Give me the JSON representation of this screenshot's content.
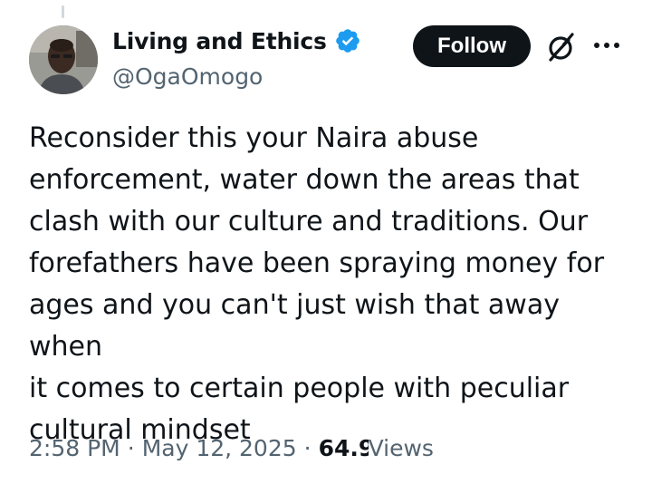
{
  "author": {
    "display_name": "Living and Ethics",
    "handle": "@OgaOmogo",
    "verified": true,
    "verified_color": "#1d9bf0"
  },
  "actions": {
    "follow_label": "Follow",
    "grok_icon": "grok-icon",
    "more_icon": "more-icon"
  },
  "tweet": {
    "text": "Reconsider this your Naira abuse\nenforcement, water down the areas that\nclash with our culture and traditions. Our\nforefathers have been spraying money for\nages and you can't just wish that away when\nit comes to certain people with peculiar\ncultural mindset"
  },
  "meta": {
    "time": "2:58 PM",
    "separator": "·",
    "date": "May 12, 2025",
    "views_count": "64.9K",
    "views_label": "Views"
  }
}
